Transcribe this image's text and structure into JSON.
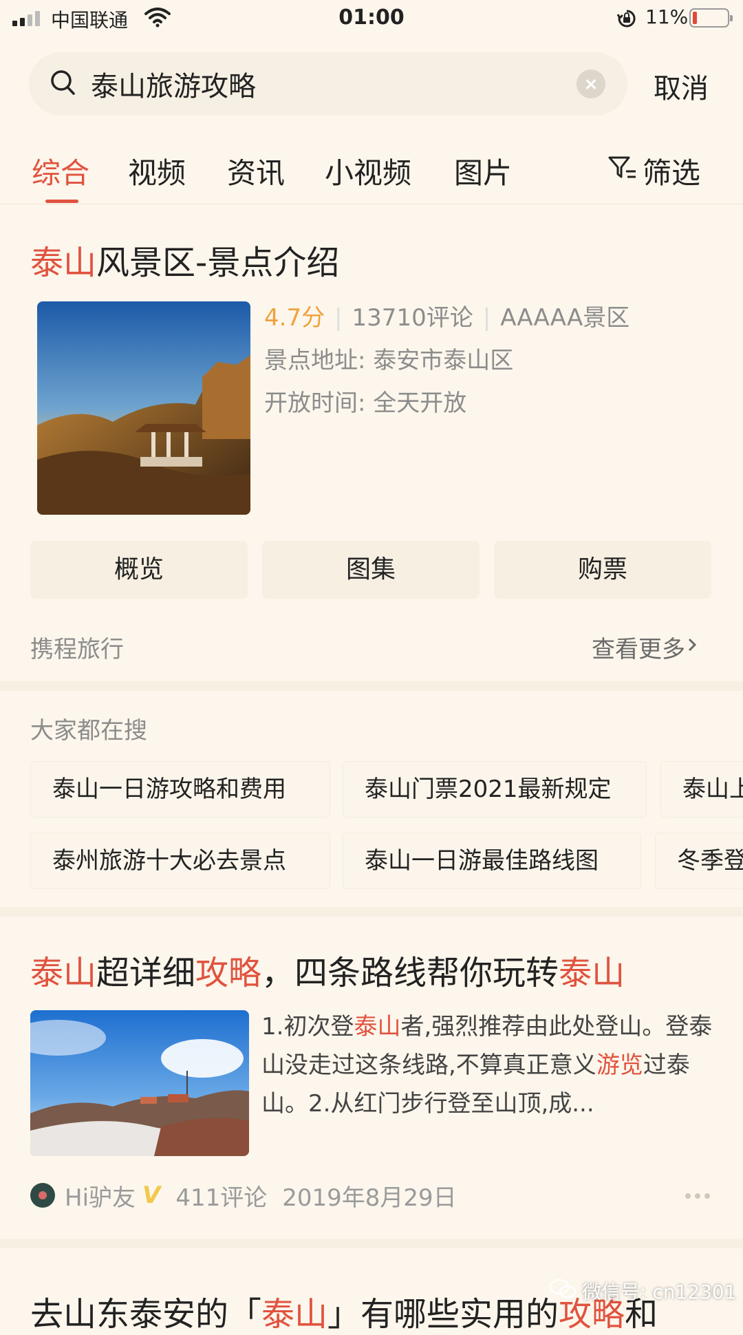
{
  "status_bar": {
    "carrier": "中国联通",
    "time": "01:00",
    "battery_percent": "11%",
    "battery_level": 0.11,
    "battery_color": "#e0483a"
  },
  "search": {
    "query": "泰山旅游攻略",
    "cancel_label": "取消"
  },
  "tabs": {
    "items": [
      "综合",
      "视频",
      "资讯",
      "小视频",
      "图片"
    ],
    "active_index": 0,
    "filter_label": "筛选",
    "accent_color": "#e0533f"
  },
  "scenic_card": {
    "title_highlight": "泰山",
    "title_rest": "风景区-景点介绍",
    "score": "4.7分",
    "reviews": "13710评论",
    "grade": "AAAAA景区",
    "address": "景点地址: 泰安市泰山区",
    "hours": "开放时间: 全天开放",
    "buttons": [
      "概览",
      "图集",
      "购票"
    ],
    "source": "携程旅行",
    "more_label": "查看更多",
    "image_icon": "mountain-pavilion-photo"
  },
  "hot_searches": {
    "title": "大家都在搜",
    "row1": [
      "泰山一日游攻略和费用",
      "泰山门票2021最新规定",
      "泰山上"
    ],
    "row2": [
      "泰州旅游十大必去景点",
      "泰山一日游最佳路线图",
      "冬季登"
    ]
  },
  "article": {
    "title_parts": [
      "泰山",
      "超详细",
      "攻略",
      "，四条路线帮你玩转",
      "泰山"
    ],
    "snippet_parts": [
      "1.初次登",
      "泰山",
      "者,强烈推荐由此处登山。登泰山没走过这条线路,不算真正意义",
      "游览",
      "过泰山。2.从红门步行登至山顶,成..."
    ],
    "author": "Hi驴友",
    "verified_badge": "V",
    "comments": "411评论",
    "date": "2019年8月29日",
    "image_icon": "mountain-sky-photo"
  },
  "next_article": {
    "title_parts": [
      "去山东泰安的「",
      "泰山",
      "」有哪些实用的",
      "攻略",
      "和"
    ]
  },
  "watermark": {
    "text": "微信号: cn12301"
  }
}
